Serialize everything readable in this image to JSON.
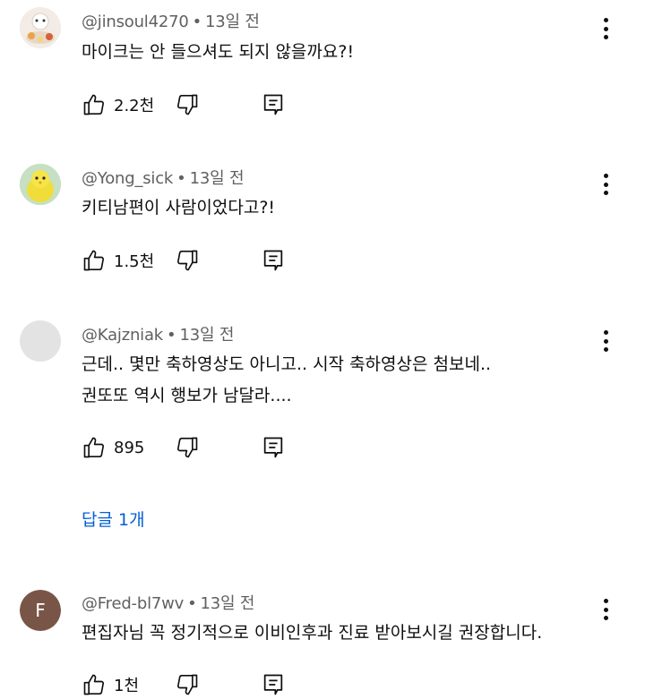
{
  "comments": [
    {
      "author": "@jinsoul4270",
      "time": "13일 전",
      "lines": [
        "마이크는 안 들으셔도 되지 않을까요?!"
      ],
      "likes": "2.2천",
      "avatar_icon": "food-photo-avatar"
    },
    {
      "author": "@Yong_sick",
      "time": "13일 전",
      "lines": [
        "키티남편이 사람이었다고?!"
      ],
      "likes": "1.5천",
      "avatar_icon": "yellow-bird-avatar"
    },
    {
      "author": "@Kajzniak",
      "time": "13일 전",
      "lines": [
        "근데.. 몇만 축하영상도 아니고.. 시작 축하영상은 첨보네..",
        "권또또 역시 행보가 남달라...."
      ],
      "likes": "895",
      "avatar_icon": "blank-avatar",
      "replies_label": "답글 1개"
    },
    {
      "author": "@Fred-bl7wv",
      "time": "13일 전",
      "lines": [
        "편집자님 꼭 정기적으로 이비인후과 진료 받아보시길 권장합니다."
      ],
      "likes": "1천",
      "avatar_letter": "F",
      "avatar_color": "#795548"
    }
  ],
  "separator": "•",
  "colors": {
    "meta_text": "#606060",
    "link": "#065fd4",
    "text": "#0f0f0f"
  }
}
